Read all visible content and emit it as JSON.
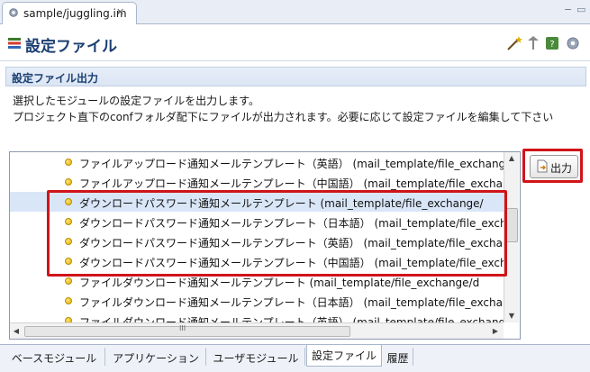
{
  "editor_tab": {
    "title": "sample/juggling.im",
    "close_symbol": "✕"
  },
  "window_controls": {
    "minimize": "−",
    "maximize": "▭"
  },
  "form": {
    "title": "設定ファイル",
    "icon": "form-list-icon",
    "toolbar_icons": [
      "wand-icon",
      "pin-icon",
      "help-icon",
      "gear-icon"
    ]
  },
  "section": {
    "title": "設定ファイル出力",
    "description": [
      "選択したモジュールの設定ファイルを出力します。",
      "プロジェクト直下のconfフォルダ配下にファイルが出力されます。必要に応じて設定ファイルを編集して下さい"
    ]
  },
  "list": {
    "items": [
      {
        "label": "ファイルアップロード通知メールテンプレート（英語） (mail_template/file_exchange/",
        "selected": false
      },
      {
        "label": "ファイルアップロード通知メールテンプレート（中国語） (mail_template/file_exchange/",
        "selected": false
      },
      {
        "label": "ダウンロードパスワード通知メールテンプレート (mail_template/file_exchange/",
        "selected": true
      },
      {
        "label": "ダウンロードパスワード通知メールテンプレート（日本語） (mail_template/file_exchange/",
        "selected": false
      },
      {
        "label": "ダウンロードパスワード通知メールテンプレート（英語） (mail_template/file_exchange/",
        "selected": false
      },
      {
        "label": "ダウンロードパスワード通知メールテンプレート（中国語） (mail_template/file_exchange/",
        "selected": false
      },
      {
        "label": "ファイルダウンロード通知メールテンプレート (mail_template/file_exchange/d",
        "selected": false
      },
      {
        "label": "ファイルダウンロード通知メールテンプレート（日本語） (mail_template/file_exchange/",
        "selected": false
      },
      {
        "label": "ファイルダウンロード通知メールテンプレート（英語） (mail_template/file_exchange/",
        "selected": false
      }
    ],
    "scroll": {
      "up": "▲",
      "down": "▼",
      "left": "◀",
      "right": "▶",
      "grip": "III"
    }
  },
  "output_button": {
    "label": "出力",
    "icon": "export-doc-icon"
  },
  "bottom_tabs": [
    {
      "label": "ベースモジュール",
      "active": false
    },
    {
      "label": "アプリケーション",
      "active": false
    },
    {
      "label": "ユーザモジュール",
      "active": false
    },
    {
      "label": "設定ファイル",
      "active": true
    },
    {
      "label": "履歴",
      "active": false
    }
  ],
  "colors": {
    "highlight": "#d0141a",
    "selection": "#d9e6f7",
    "title": "#1b3f72"
  }
}
